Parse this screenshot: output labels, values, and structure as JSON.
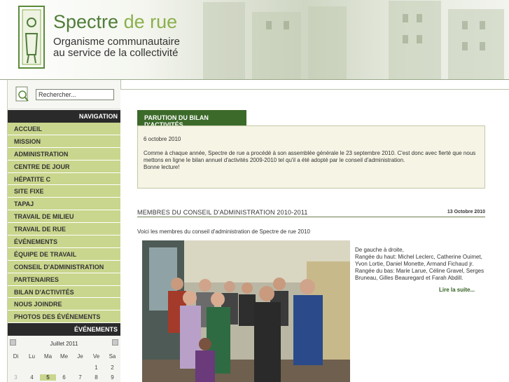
{
  "header": {
    "site_title_part1": "Spectre",
    "site_title_part2": "de rue",
    "tagline_line1": "Organisme communautaire",
    "tagline_line2": "au service de la collectivité",
    "logo": "spectre-de-rue-logo"
  },
  "search": {
    "placeholder": "Rechercher...",
    "value": "Rechercher...",
    "icon": "search-icon"
  },
  "navigation": {
    "title": "NAVIGATION",
    "items": [
      {
        "label": "ACCUEIL"
      },
      {
        "label": "MISSION"
      },
      {
        "label": "ADMINISTRATION"
      },
      {
        "label": "CENTRE DE JOUR"
      },
      {
        "label": "HÉPATITE C"
      },
      {
        "label": "SITE FIXE"
      },
      {
        "label": "TAPAJ"
      },
      {
        "label": "TRAVAIL DE MILIEU"
      },
      {
        "label": "TRAVAIL DE RUE"
      },
      {
        "label": "ÉVÉNEMENTS"
      },
      {
        "label": "ÉQUIPE DE TRAVAIL"
      },
      {
        "label": "CONSEIL D'ADMINISTRATION"
      },
      {
        "label": "PARTENAIRES"
      },
      {
        "label": "BILAN D'ACTIVITÉS"
      },
      {
        "label": "NOUS JOINDRE"
      },
      {
        "label": "PHOTOS DES ÉVÉNEMENTS"
      }
    ]
  },
  "events": {
    "title": "ÉVÉNEMENTS",
    "calendar": {
      "month": "Juillet 2011",
      "days": [
        "Di",
        "Lu",
        "Ma",
        "Me",
        "Je",
        "Ve",
        "Sa"
      ],
      "row1": [
        "",
        "",
        "",
        "",
        "",
        "1",
        "2"
      ],
      "row2": [
        "3",
        "4",
        "5",
        "6",
        "7",
        "8",
        "9"
      ],
      "today": "5"
    }
  },
  "notice": {
    "tab_label": "PARUTION DU BILAN D'ACTIVITÉS",
    "date": "6 octobre 2010",
    "body": "Comme à chaque année,  Spectre de rue a procédé à son assemblée générale le 23 septembre 2010.  C'est donc avec fierté que nous mettons en ligne le bilan  annuel d'activités 2009-2010 tel qu'il a été adopté par le conseil d'administration.",
    "closing": "Bonne lecture!"
  },
  "article": {
    "title": "MEMBRES DU CONSEIL D'ADMINISTRATION 2010-2011",
    "date": "13 Octobre 2010",
    "intro": "Voici les membres du conseil d'administration de Spectre de rue 2010",
    "caption": "De gauche à droite,\nRangée du haut: Michel Leclerc, Catherine Ouimet, Yvon Lortie, Daniel Monette, Armand Fichaud jr.\nRangée du bas: Marie Larue, Céline Gravel, Serges Bruneau, Gilles Beauregard et Farah Abdill.",
    "read_more": "Lire la suite..."
  },
  "colors": {
    "brand_green": "#3c6a2a",
    "nav_green": "#c9d68d",
    "dark_header": "#2a2a2a"
  }
}
